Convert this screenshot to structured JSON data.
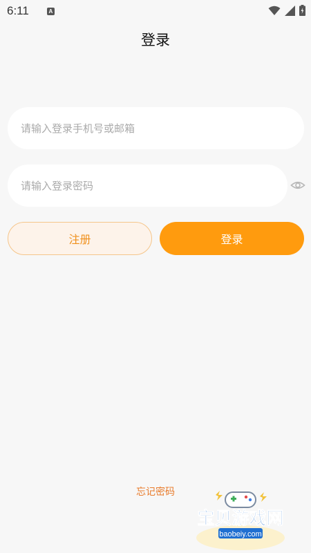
{
  "status_bar": {
    "time": "6:11",
    "notification_letter": "A"
  },
  "page": {
    "title": "登录"
  },
  "form": {
    "phone_placeholder": "请输入登录手机号或邮箱",
    "password_placeholder": "请输入登录密码"
  },
  "buttons": {
    "register_label": "注册",
    "login_label": "登录"
  },
  "links": {
    "forgot_password": "忘记密码"
  },
  "watermark": {
    "brand_text": "宝贝游戏网",
    "domain_text": "baobeiy.com"
  },
  "colors": {
    "accent": "#ff9b0e",
    "register_text": "#f0901c",
    "register_bg": "#fdf3ea",
    "forgot_text": "#e87b2b",
    "background": "#f7f7f7"
  },
  "icons": [
    "wifi-icon",
    "cell-signal-icon",
    "battery-icon",
    "eye-icon",
    "gamepad-icon"
  ]
}
